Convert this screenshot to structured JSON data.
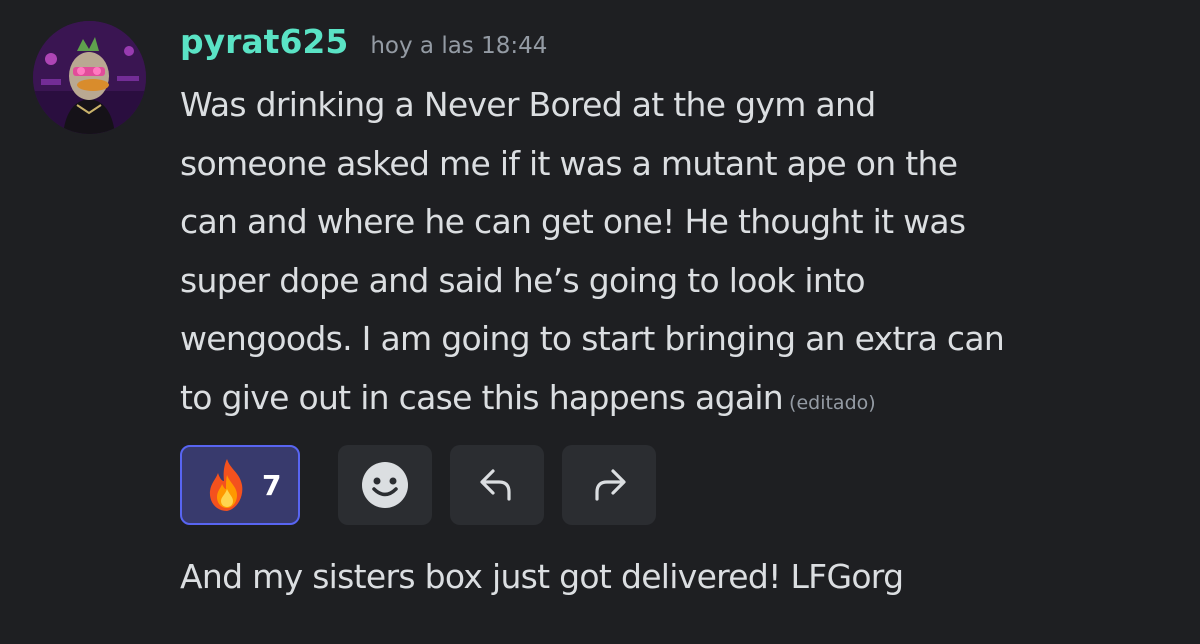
{
  "message": {
    "author": "pyrat625",
    "timestamp": "hoy a las 18:44",
    "content_lines": [
      "Was drinking a Never Bored at the gym and",
      "someone asked me if it was a mutant ape on the",
      "can and where he can get one! He thought it was",
      "super dope and said he’s going to look into",
      "wengoods. I am going to start bringing an extra can",
      "to give out in case this happens again"
    ],
    "edited_label": "(editado)",
    "avatar_icon": "avatar-duck-icon",
    "colors": {
      "background": "#1e1f22",
      "username": "#5ae3c5",
      "text": "#dbdee1",
      "muted": "#949ba4",
      "reaction_border": "#5865f2",
      "reaction_bg": "#383a6d",
      "button_bg": "#2b2d31"
    }
  },
  "reactions": [
    {
      "emoji": "fire-icon",
      "count": "7"
    }
  ],
  "actions": {
    "add_reaction_icon": "smiley-face-icon",
    "reply_icon": "reply-arrow-icon",
    "forward_icon": "forward-arrow-icon"
  },
  "followup_message": {
    "content": "And my sisters box just got delivered! LFGorg"
  }
}
